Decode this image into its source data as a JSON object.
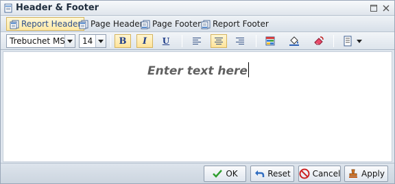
{
  "window": {
    "title": "Header & Footer"
  },
  "tabs": [
    {
      "label": "Report Header",
      "active": true
    },
    {
      "label": "Page Header",
      "active": false
    },
    {
      "label": "Page Footer",
      "active": false
    },
    {
      "label": "Report Footer",
      "active": false
    }
  ],
  "toolbar": {
    "font_family": "Trebuchet MS",
    "font_size": "14",
    "bold_label": "B",
    "italic_label": "I",
    "underline_label": "U",
    "bold_active": true,
    "italic_active": true,
    "align_selected": "center"
  },
  "editor": {
    "content": "Enter text here"
  },
  "buttons": {
    "ok": "OK",
    "reset": "Reset",
    "cancel": "Cancel",
    "apply": "Apply"
  },
  "colors": {
    "accent_active": "#ffe39a",
    "ok_green": "#2e9e2e",
    "cancel_red": "#cc2222"
  }
}
